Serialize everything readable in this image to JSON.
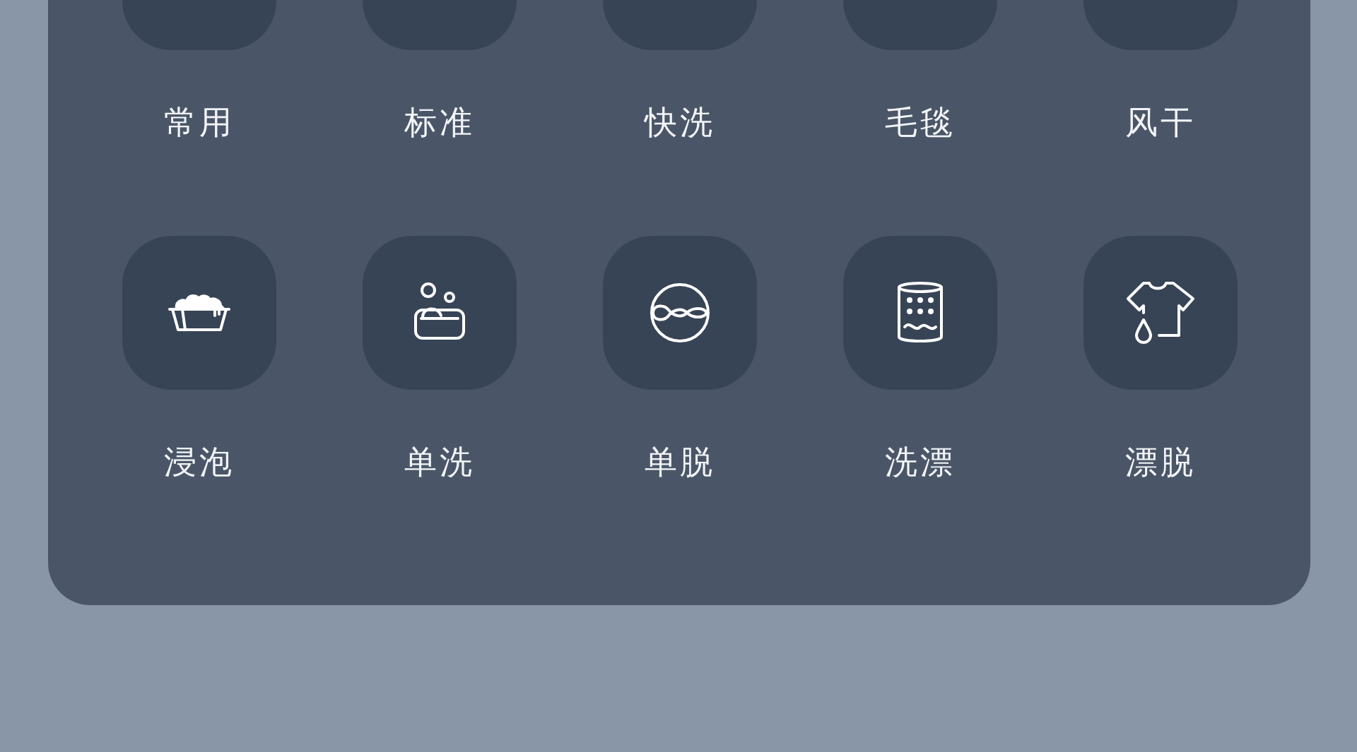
{
  "modes": [
    {
      "label": "常用"
    },
    {
      "label": "标准"
    },
    {
      "label": "快洗"
    },
    {
      "label": "毛毯"
    },
    {
      "label": "风干"
    },
    {
      "label": "浸泡"
    },
    {
      "label": "单洗"
    },
    {
      "label": "单脱"
    },
    {
      "label": "洗漂"
    },
    {
      "label": "漂脱"
    }
  ]
}
